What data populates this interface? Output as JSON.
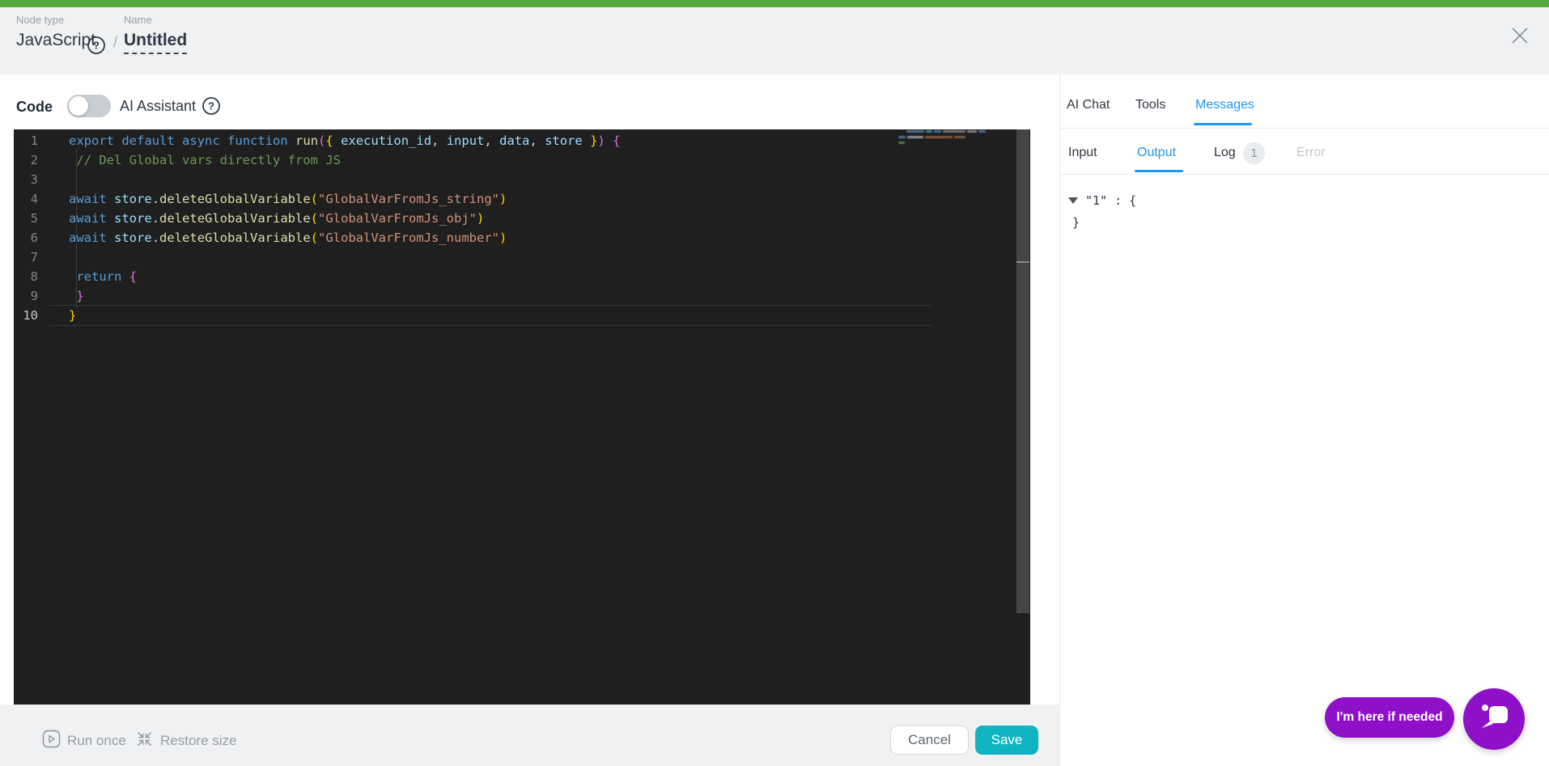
{
  "header": {
    "node_type_label": "Node type",
    "node_type_value": "JavaScript",
    "separator": "/",
    "name_label": "Name",
    "name_value": "Untitled"
  },
  "toolbar": {
    "code_label": "Code",
    "ai_assistant_label": "AI Assistant",
    "ai_toggle_state": "off"
  },
  "editor": {
    "language": "javascript",
    "active_line": "10",
    "lines": [
      {
        "n": "1",
        "segs": [
          [
            "kw",
            "export"
          ],
          [
            "pl",
            " "
          ],
          [
            "kw",
            "default"
          ],
          [
            "pl",
            " "
          ],
          [
            "kw",
            "async"
          ],
          [
            "pl",
            " "
          ],
          [
            "kw",
            "function"
          ],
          [
            "pl",
            " "
          ],
          [
            "fn",
            "run"
          ],
          [
            "b2",
            "("
          ],
          [
            "b1",
            "{"
          ],
          [
            "pl",
            " "
          ],
          [
            "vr",
            "execution_id"
          ],
          [
            "pl",
            ", "
          ],
          [
            "vr",
            "input"
          ],
          [
            "pl",
            ", "
          ],
          [
            "vr",
            "data"
          ],
          [
            "pl",
            ", "
          ],
          [
            "vr",
            "store"
          ],
          [
            "pl",
            " "
          ],
          [
            "b1",
            "}"
          ],
          [
            "b2",
            ")"
          ],
          [
            "pl",
            " "
          ],
          [
            "b2",
            "{"
          ]
        ]
      },
      {
        "n": "2",
        "segs": [
          [
            "cm",
            " // Del Global vars directly from JS"
          ]
        ]
      },
      {
        "n": "3",
        "segs": []
      },
      {
        "n": "4",
        "segs": [
          [
            "kw",
            "await"
          ],
          [
            "pl",
            " "
          ],
          [
            "vr",
            "store"
          ],
          [
            "pl",
            "."
          ],
          [
            "fn",
            "deleteGlobalVariable"
          ],
          [
            "b1",
            "("
          ],
          [
            "st",
            "\"GlobalVarFromJs_string\""
          ],
          [
            "b1",
            ")"
          ]
        ]
      },
      {
        "n": "5",
        "segs": [
          [
            "kw",
            "await"
          ],
          [
            "pl",
            " "
          ],
          [
            "vr",
            "store"
          ],
          [
            "pl",
            "."
          ],
          [
            "fn",
            "deleteGlobalVariable"
          ],
          [
            "b1",
            "("
          ],
          [
            "st",
            "\"GlobalVarFromJs_obj\""
          ],
          [
            "b1",
            ")"
          ]
        ]
      },
      {
        "n": "6",
        "segs": [
          [
            "kw",
            "await"
          ],
          [
            "pl",
            " "
          ],
          [
            "vr",
            "store"
          ],
          [
            "pl",
            "."
          ],
          [
            "fn",
            "deleteGlobalVariable"
          ],
          [
            "b1",
            "("
          ],
          [
            "st",
            "\"GlobalVarFromJs_number\""
          ],
          [
            "b1",
            ")"
          ]
        ]
      },
      {
        "n": "7",
        "segs": []
      },
      {
        "n": "8",
        "segs": [
          [
            "pl",
            " "
          ],
          [
            "kw",
            "return"
          ],
          [
            "pl",
            " "
          ],
          [
            "b2",
            "{"
          ]
        ]
      },
      {
        "n": "9",
        "segs": [
          [
            "pl",
            " "
          ],
          [
            "b2",
            "}"
          ]
        ]
      },
      {
        "n": "10",
        "active": true,
        "segs": [
          [
            "b1",
            "}"
          ]
        ]
      }
    ]
  },
  "right_panel": {
    "tabs": [
      {
        "label": "AI Chat",
        "active": false
      },
      {
        "label": "Tools",
        "active": false
      },
      {
        "label": "Messages",
        "active": true
      }
    ],
    "subtabs": [
      {
        "label": "Input",
        "active": false
      },
      {
        "label": "Output",
        "active": true
      },
      {
        "label": "Log",
        "active": false,
        "badge": "1"
      },
      {
        "label": "Error",
        "active": false,
        "disabled": true
      }
    ],
    "output": {
      "line1": "\"1\" : {",
      "line2": "}"
    }
  },
  "footer": {
    "run_once_label": "Run once",
    "restore_size_label": "Restore size",
    "cancel_label": "Cancel",
    "save_label": "Save"
  },
  "chat": {
    "pill_label": "I'm here if needed"
  },
  "colors": {
    "brand_green": "#57a83d",
    "accent_blue": "#2196f3",
    "save_teal": "#10b3c1",
    "chat_purple": "#8e10c8",
    "editor_bg": "#1f1f1f",
    "keyword_blue": "#569cd6",
    "string_orange": "#ce9178",
    "comment_green": "#6a9955"
  }
}
